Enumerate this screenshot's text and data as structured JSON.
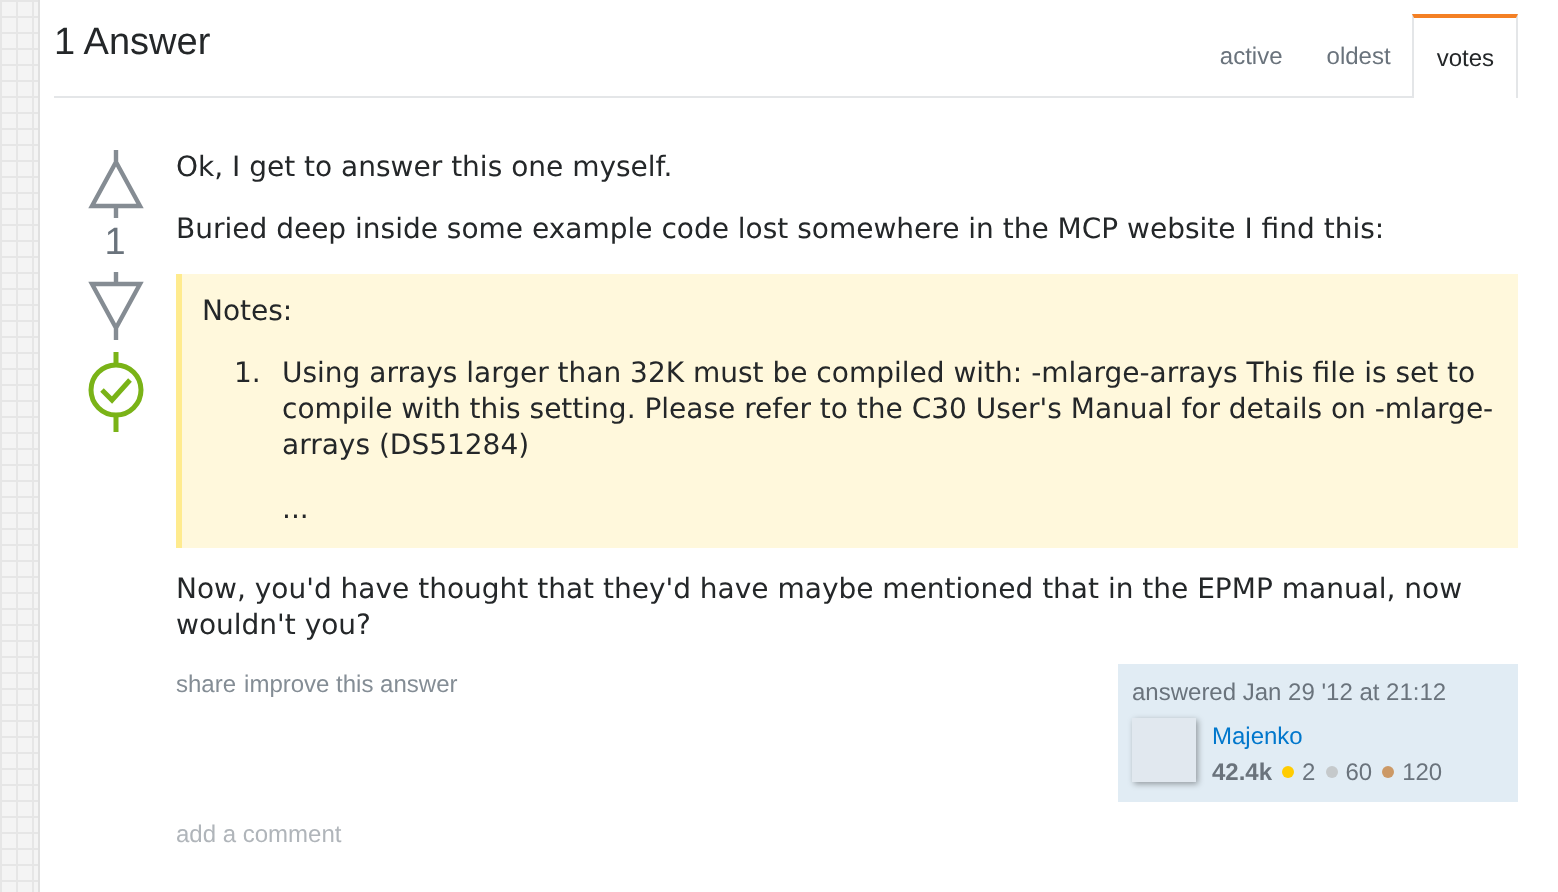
{
  "header": {
    "title": "1 Answer",
    "tabs": [
      {
        "label": "active",
        "selected": false
      },
      {
        "label": "oldest",
        "selected": false
      },
      {
        "label": "votes",
        "selected": true
      }
    ]
  },
  "answer": {
    "score": "1",
    "accepted": true,
    "paragraphs": [
      "Ok, I get to answer this one myself.",
      "Buried deep inside some example code lost somewhere in the MCP website I find this:"
    ],
    "quote": {
      "heading": "Notes:",
      "items": [
        {
          "marker": "1.",
          "text": "Using arrays larger than 32K must be compiled with: -mlarge-arrays This file is set to compile with this setting. Please refer to the C30 User's Manual for details on -mlarge-arrays (DS51284)",
          "extra": "..."
        }
      ]
    },
    "closing": "Now, you'd have thought that they'd have maybe mentioned that in the EPMP manual, now wouldn't you?",
    "links": [
      "share",
      "improve this answer"
    ],
    "signature": {
      "action": "answered Jan 29 '12 at 21:12",
      "user": "Majenko",
      "reputation": "42.4k",
      "badges": [
        {
          "count": "2",
          "color": "#ffcc01"
        },
        {
          "count": "60",
          "color": "#c5c9cb"
        },
        {
          "count": "120",
          "color": "#cc9966"
        }
      ]
    },
    "add_comment": "add a comment"
  }
}
